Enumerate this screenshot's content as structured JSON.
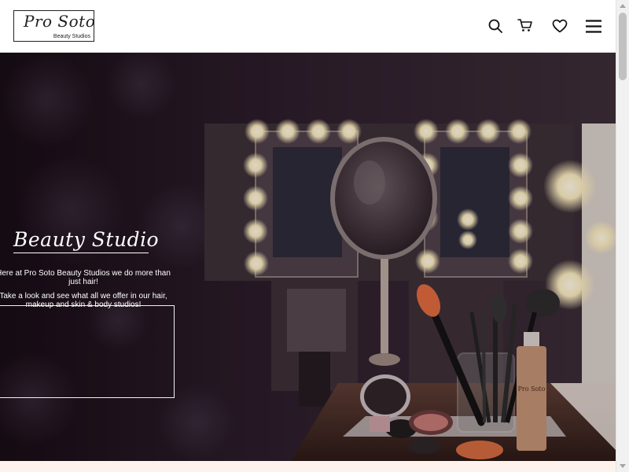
{
  "header": {
    "logo": {
      "script": "Pro Soto",
      "subtitle": "Beauty Studios"
    },
    "icons": {
      "search": "search-icon",
      "cart": "cart-icon",
      "wishlist": "heart-icon",
      "menu": "hamburger-menu-icon"
    }
  },
  "hero": {
    "title": "Beauty Studio",
    "line1": "Here at Pro Soto Beauty Studios we do more than just hair!",
    "line2": "Take a look and see what all we offer in our hair, makeup and skin & body studios!",
    "product_label": "Pro Soto"
  },
  "colors": {
    "header_bg": "#ffffff",
    "hero_dark": "#1a1118",
    "bulb": "#fff3c9",
    "strip": "#fdf3ec"
  }
}
